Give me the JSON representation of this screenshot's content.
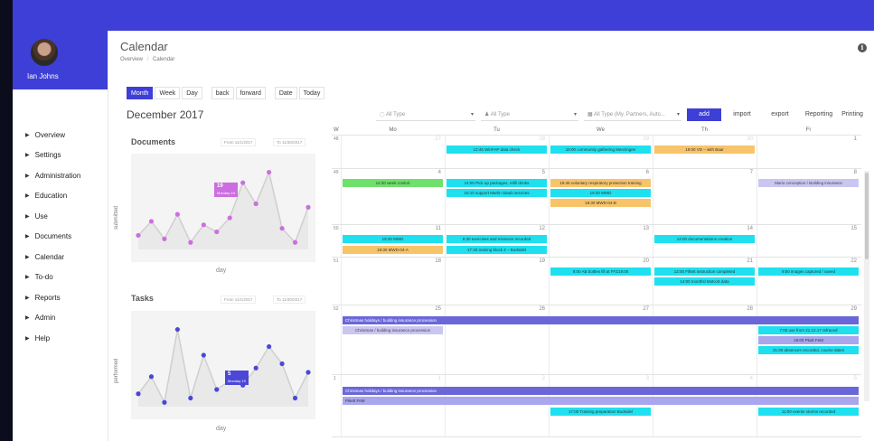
{
  "user": {
    "name": "Ian Johns"
  },
  "nav": [
    {
      "label": "Overview"
    },
    {
      "label": "Settings"
    },
    {
      "label": "Administration"
    },
    {
      "label": "Education"
    },
    {
      "label": "Use"
    },
    {
      "label": "Documents"
    },
    {
      "label": "Calendar"
    },
    {
      "label": "To-do"
    },
    {
      "label": "Reports"
    },
    {
      "label": "Admin"
    },
    {
      "label": "Help"
    }
  ],
  "page": {
    "title": "Calendar",
    "breadcrumb": [
      "Overview",
      "/",
      "Calendar"
    ]
  },
  "view_buttons": [
    "Month",
    "Week",
    "Day",
    "back",
    "forward",
    "Date",
    "Today"
  ],
  "month_title": "December 2017",
  "filters": [
    {
      "label": "All Type"
    },
    {
      "label": "All Type"
    },
    {
      "label": "All Type (My, Partners, Auto...",
      "caret": "▾"
    }
  ],
  "actions": [
    "add",
    "import",
    "export",
    "Reporting",
    "Printing"
  ],
  "documents_panel": {
    "title": "Documents",
    "from": "From 11/1/2017",
    "to": "To 11/30/2017",
    "ylabel": "submitted",
    "xlabel": "day",
    "tooltip_value": "19",
    "tooltip_label": "Monday 19"
  },
  "tasks_panel": {
    "title": "Tasks",
    "from": "From 11/1/2017",
    "to": "To 11/30/2017",
    "ylabel": "performed",
    "xlabel": "day",
    "tooltip_value": "5",
    "tooltip_label": "Monday 19"
  },
  "chart_data": [
    {
      "type": "line",
      "title": "Documents",
      "xlabel": "day",
      "ylabel": "submitted",
      "color": "#cc6ee0",
      "x": [
        1,
        2,
        3,
        4,
        5,
        6,
        7,
        8,
        9,
        10,
        11,
        12,
        13,
        14
      ],
      "values": [
        4,
        8,
        3,
        10,
        2,
        7,
        5,
        9,
        19,
        13,
        22,
        6,
        2,
        12
      ]
    },
    {
      "type": "line",
      "title": "Tasks",
      "xlabel": "day",
      "ylabel": "performed",
      "color": "#4b48d6",
      "x": [
        1,
        2,
        3,
        4,
        5,
        6,
        7,
        8,
        9,
        10,
        11,
        12,
        13,
        14
      ],
      "values": [
        3,
        7,
        1,
        18,
        2,
        12,
        4,
        6,
        5,
        9,
        14,
        10,
        2,
        8
      ]
    }
  ],
  "calendar": {
    "week_label": "W",
    "days": [
      "Mo",
      "Tu",
      "We",
      "Th",
      "Fr"
    ],
    "weeks": [
      {
        "num": "48",
        "dates": [
          "27",
          "28",
          "29",
          "30",
          "1"
        ],
        "muted": [
          true,
          true,
          true,
          true,
          false
        ]
      },
      {
        "num": "49",
        "dates": [
          "4",
          "5",
          "6",
          "7",
          "8"
        ],
        "muted": [
          false,
          false,
          false,
          false,
          false
        ]
      },
      {
        "num": "50",
        "dates": [
          "11",
          "12",
          "13",
          "14",
          "15"
        ],
        "muted": [
          false,
          false,
          false,
          false,
          false
        ]
      },
      {
        "num": "51",
        "dates": [
          "18",
          "19",
          "20",
          "21",
          "22"
        ],
        "muted": [
          false,
          false,
          false,
          false,
          false
        ]
      },
      {
        "num": "52",
        "dates": [
          "25",
          "26",
          "27",
          "28",
          "29"
        ],
        "muted": [
          false,
          false,
          false,
          false,
          false
        ]
      },
      {
        "num": "1",
        "dates": [
          "1",
          "2",
          "3",
          "4",
          "5"
        ],
        "muted": [
          true,
          true,
          true,
          true,
          true
        ]
      }
    ],
    "events": [
      {
        "text": "12:45 WinFAP data check",
        "color": "cyan"
      },
      {
        "text": "18:00 community gathering Menzingen",
        "color": "cyan"
      },
      {
        "text": "19:00 VD – with Baar",
        "color": "orange"
      },
      {
        "text": "14:30 week control",
        "color": "green"
      },
      {
        "text": "14:00 Pick up packages, refill drinks",
        "color": "cyan"
      },
      {
        "text": "16:10 support Martin Staub services",
        "color": "cyan"
      },
      {
        "text": "18:45 voluntary respiratory protection training",
        "color": "orange"
      },
      {
        "text": "19:30 MWD",
        "color": "cyan"
      },
      {
        "text": "19:30 MWD-04-B",
        "color": "orange"
      },
      {
        "text": "Mario conception / Building insurance",
        "color": "lav"
      },
      {
        "text": "19:30 MWD",
        "color": "cyan"
      },
      {
        "text": "19:30 MWD-04-A",
        "color": "orange"
      },
      {
        "text": "6:30 exercises and missions recorded",
        "color": "cyan"
      },
      {
        "text": "17:30 training block 2 – Bodsidel",
        "color": "cyan"
      },
      {
        "text": "14:00 documentations creation",
        "color": "cyan"
      },
      {
        "text": "9:00 AB bottles fill at FFZ19:00",
        "color": "cyan"
      },
      {
        "text": "12:00 Fiftett instruction completed",
        "color": "cyan"
      },
      {
        "text": "14:00 monthsl MoKoS data",
        "color": "cyan"
      },
      {
        "text": "9:50 images captured / saved",
        "color": "cyan"
      },
      {
        "text": "Christmas holidays / building insurance procession",
        "color": "purple"
      },
      {
        "text": "Christmas / building insurance procession",
        "color": "lav"
      },
      {
        "text": "7:00 use from 21.12.17 refraced",
        "color": "cyan"
      },
      {
        "text": "19:00 Pkult FeM",
        "color": "lav2"
      },
      {
        "text": "21:00 absences recorded, course dates",
        "color": "cyan"
      },
      {
        "text": "Christmas holidays / building insurance procession",
        "color": "purple"
      },
      {
        "text": "Pikett FeM",
        "color": "lav2"
      },
      {
        "text": "17:00 Training preparation Bodsidel",
        "color": "cyan"
      },
      {
        "text": "11:00 events storms recorded",
        "color": "cyan"
      }
    ]
  }
}
